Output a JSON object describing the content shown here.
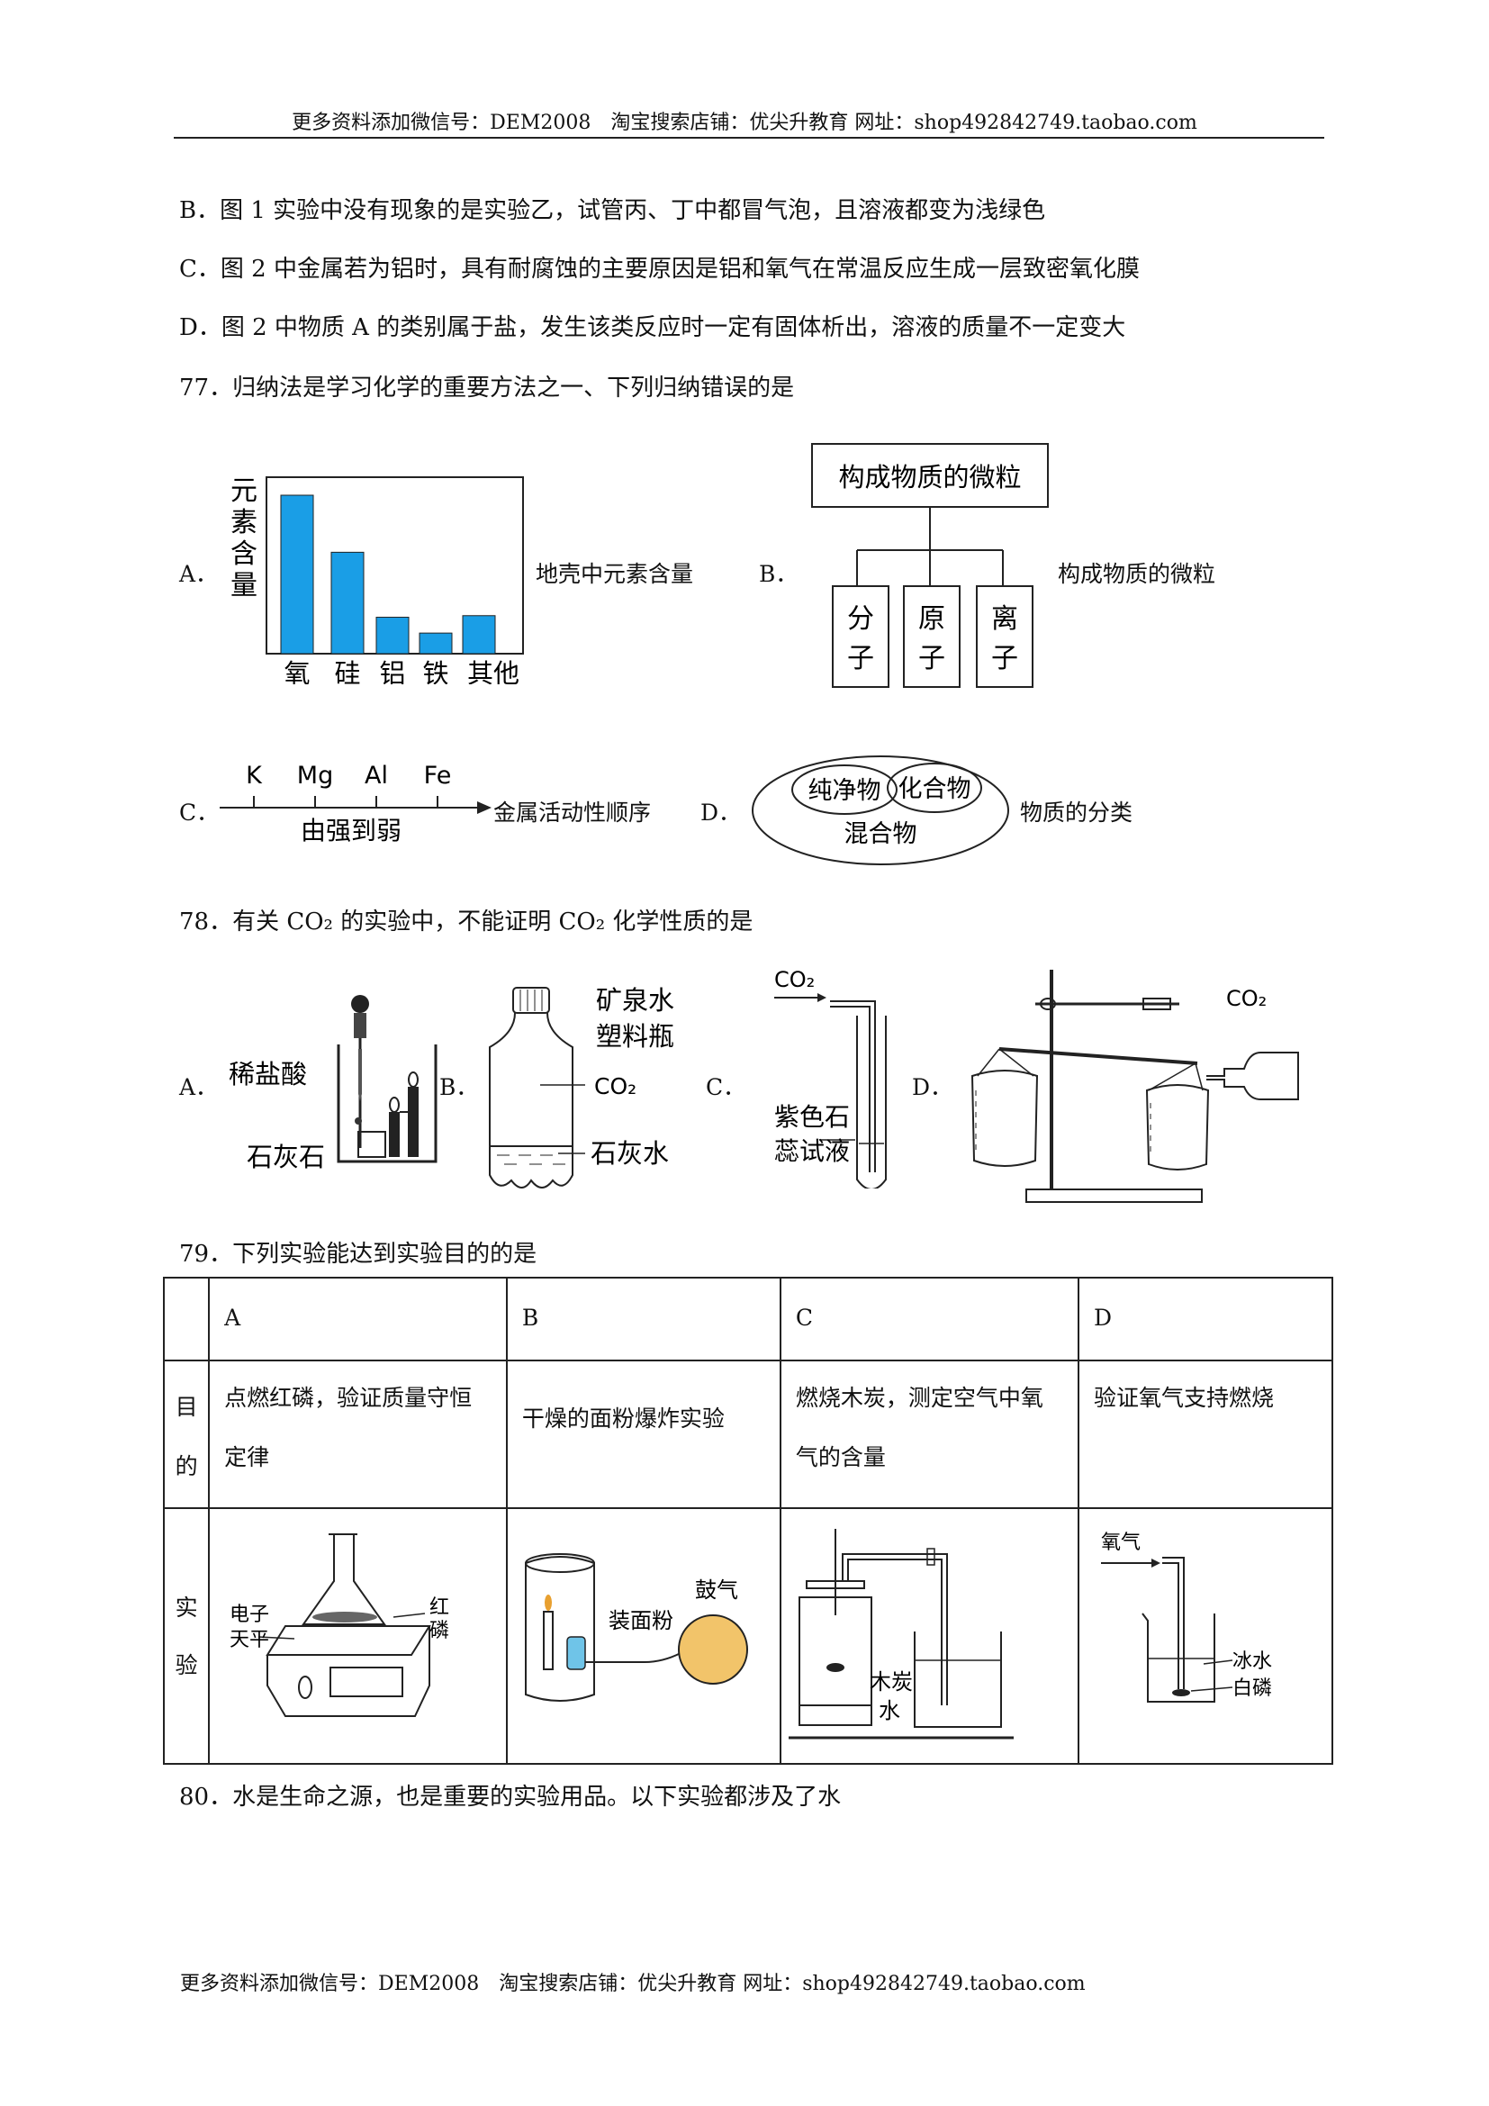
{
  "header": {
    "text": "更多资料添加微信号：DEM2008　淘宝搜索店铺：优尖升教育  网址：shop492842749.taobao.com"
  },
  "footer": {
    "text": "更多资料添加微信号：DEM2008　淘宝搜索店铺：优尖升教育  网址：shop492842749.taobao.com"
  },
  "options_prev": {
    "B": "B．图 1 实验中没有现象的是实验乙，试管丙、丁中都冒气泡，且溶液都变为浅绿色",
    "C": "C．图 2 中金属若为铝时，具有耐腐蚀的主要原因是铝和氧气在常温反应生成一层致密氧化膜",
    "D": "D．图 2  中物质 A 的类别属于盐，发生该类反应时一定有固体析出，溶液的质量不一定变大"
  },
  "q77": {
    "stem": "77．归纳法是学习化学的重要方法之一、下列归纳错误的是",
    "A": {
      "letter": "A．",
      "ylabel": "元素含量",
      "caption": "地壳中元素含量",
      "chart_data": {
        "type": "bar",
        "categories": [
          "氧",
          "硅",
          "铝",
          "铁",
          "其他"
        ],
        "values": [
          100,
          64,
          23,
          13,
          24
        ],
        "ylabel": "元素含量",
        "color": "#1a9ee6"
      }
    },
    "B": {
      "letter": "B．",
      "top": "构成物质的微粒",
      "children": [
        "分子",
        "原子",
        "离子"
      ],
      "caption": "构成物质的微粒"
    },
    "C": {
      "letter": "C．",
      "metals": [
        "K",
        "Mg",
        "Al",
        "Fe"
      ],
      "arrow_label": "由强到弱",
      "caption": "金属活动性顺序"
    },
    "D": {
      "letter": "D．",
      "inner1": "纯净物",
      "inner2": "化合物",
      "outer": "混合物",
      "caption": "物质的分类"
    }
  },
  "q78": {
    "stem": "78．有关 CO₂ 的实验中，不能证明 CO₂ 化学性质的是",
    "A": {
      "letter": "A．",
      "label1": "稀盐酸",
      "label2": "石灰石"
    },
    "B": {
      "letter": "B．",
      "label1": "矿泉水",
      "label2": "塑料瓶",
      "label3": "CO₂",
      "label4": "石灰水"
    },
    "C": {
      "letter": "C．",
      "label1": "CO₂",
      "label2": "紫色石",
      "label3": "蕊试液"
    },
    "D": {
      "letter": "D．",
      "label1": "CO₂"
    }
  },
  "q79": {
    "stem": "79．下列实验能达到实验目的的是",
    "headers": [
      "A",
      "B",
      "C",
      "D"
    ],
    "row_purpose_label": [
      "目",
      "的"
    ],
    "purposes": [
      "点燃红磷，验证质量守恒定律",
      "干燥的面粉爆炸实验",
      "燃烧木炭，测定空气中氧气的含量",
      "验证氧气支持燃烧"
    ],
    "row_exp_label": [
      "实",
      "验"
    ],
    "figA": {
      "l1": "电子",
      "l2": "天平",
      "l3": "红",
      "l4": "磷"
    },
    "figB": {
      "l1": "装面粉",
      "l2": "鼓气"
    },
    "figC": {
      "l1": "木炭",
      "l2": "水"
    },
    "figD": {
      "l1": "氧气",
      "l2": "冰水",
      "l3": "白磷"
    }
  },
  "q80": {
    "stem": "80．水是生命之源，也是重要的实验用品。以下实验都涉及了水"
  }
}
